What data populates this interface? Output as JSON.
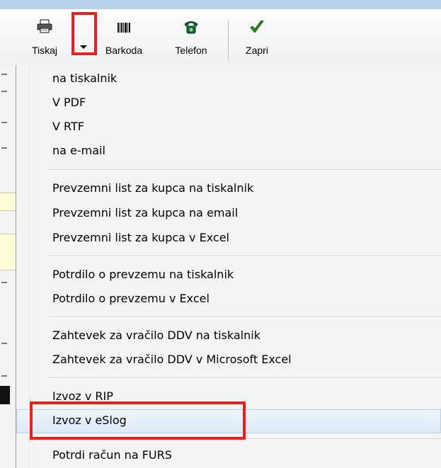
{
  "toolbar": {
    "print_label": "Tiskaj",
    "barcode_label": "Barkoda",
    "phone_label": "Telefon",
    "close_label": "Zapri"
  },
  "menu": {
    "items": [
      "na tiskalnik",
      "V PDF",
      "V RTF",
      "na e-mail",
      "Prevzemni list za kupca na tiskalnik",
      "Prevzemni list za kupca na email",
      "Prevzemni list za kupca v Excel",
      "Potrdilo o prevzemu na tiskalnik",
      "Potrdilo o prevzemu v Excel",
      "Zahtevek za vračilo DDV na tiskalnik",
      "Zahtevek za vračilo DDV v Microsoft Excel",
      "Izvoz v RIP",
      "Izvoz v eSlog",
      "Potrdi račun na FURS"
    ],
    "hovered_item": "Izvoz v eSlog"
  },
  "colors": {
    "highlight_box": "#e8211d",
    "check": "#2a8a1d",
    "phone": "#0b6b2b"
  },
  "icons": [
    "printer-icon",
    "dropdown-arrow-icon",
    "barcode-icon",
    "telephone-icon",
    "checkmark-icon"
  ]
}
